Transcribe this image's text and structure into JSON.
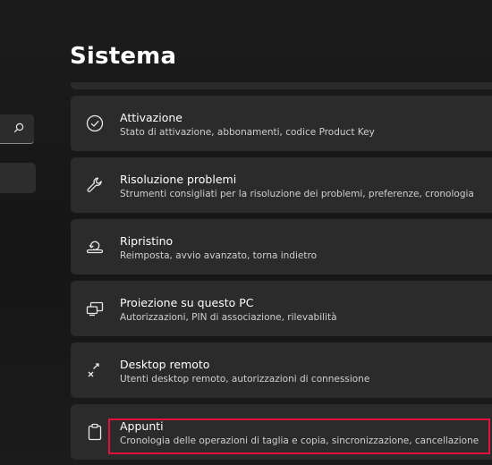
{
  "page": {
    "title": "Sistema"
  },
  "items": [
    {
      "title": "Attivazione",
      "subtitle": "Stato di attivazione, abbonamenti, codice Product Key",
      "icon": "check-circle-icon"
    },
    {
      "title": "Risoluzione problemi",
      "subtitle": "Strumenti consigliati per la risoluzione dei problemi, preferenze, cronologia",
      "icon": "wrench-icon"
    },
    {
      "title": "Ripristino",
      "subtitle": "Reimposta, avvio avanzato, torna indietro",
      "icon": "recovery-icon"
    },
    {
      "title": "Proiezione su questo PC",
      "subtitle": "Autorizzazioni, PIN di associazione, rilevabilità",
      "icon": "project-to-pc-icon"
    },
    {
      "title": "Desktop remoto",
      "subtitle": "Utenti desktop remoto, autorizzazioni di connessione",
      "icon": "remote-desktop-icon"
    },
    {
      "title": "Appunti",
      "subtitle": "Cronologia delle operazioni di taglia e copia, sincronizzazione, cancellazione",
      "icon": "clipboard-icon"
    }
  ],
  "colors": {
    "highlight": "#e0133f",
    "card": "#2b2b2b"
  }
}
